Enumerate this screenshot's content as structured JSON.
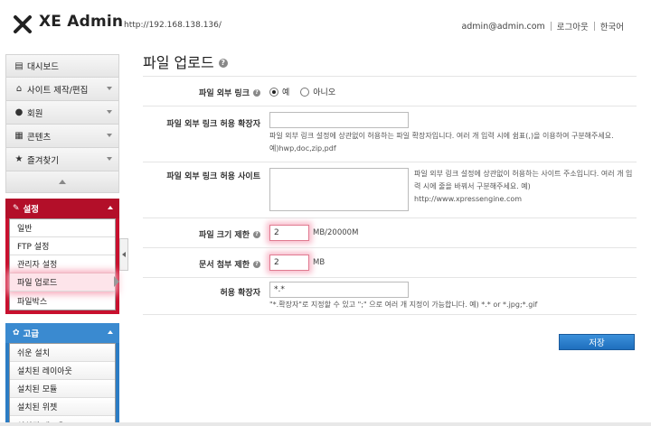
{
  "header": {
    "logo_text": "XE Admin",
    "site_url": "http://192.168.138.136/",
    "user_email": "admin@admin.com",
    "logout": "로그아웃",
    "language": "한국어"
  },
  "sidebar": {
    "items": [
      {
        "label": "대시보드",
        "icon": "dashboard-icon"
      },
      {
        "label": "사이트 제작/편집",
        "icon": "home-icon"
      },
      {
        "label": "회원",
        "icon": "user-icon"
      },
      {
        "label": "콘텐츠",
        "icon": "content-icon"
      },
      {
        "label": "즐겨찾기",
        "icon": "star-icon"
      }
    ],
    "settings_group": {
      "label": "설정",
      "items": [
        "일반",
        "FTP 설정",
        "관리자 설정",
        "파일 업로드",
        "파일박스"
      ],
      "active": "파일 업로드"
    },
    "advanced_group": {
      "label": "고급",
      "items": [
        "쉬운 설치",
        "설치된 레이아웃",
        "설치된 모듈",
        "설치된 위젯",
        "설치된 애드온"
      ]
    }
  },
  "page": {
    "title": "파일 업로드",
    "help": "?"
  },
  "form": {
    "external_link": {
      "label": "파일 외부 링크",
      "options": [
        "예",
        "아니오"
      ],
      "selected": "예"
    },
    "allowed_ext": {
      "label": "파일 외부 링크 허용 확장자",
      "value": "",
      "desc": "파일 외부 링크 설정에 상관없이 허용하는 파일 확장자입니다. 여러 개 입력 시에 쉼표(,)을 이용하여 구분해주세요. 예)hwp,doc,zip,pdf"
    },
    "allowed_sites": {
      "label": "파일 외부 링크 허용 사이트",
      "value": "",
      "desc": "파일 외부 링크 설정에 상관없이 허용하는 사이트 주소입니다. 여러 개 입력 시에 줄을 바꿔서 구분해주세요. 예) http://www.xpressengine.com"
    },
    "file_size": {
      "label": "파일 크기 제한",
      "value": "2",
      "unit": "MB/20000M"
    },
    "doc_attach": {
      "label": "문서 첨부 제한",
      "value": "2",
      "unit": "MB"
    },
    "allowed_types": {
      "label": "허용 확장자",
      "value": "*.*",
      "desc": "\"*.확장자\"로 지정할 수 있고 \";\" 으로 여러 개 지정이 가능합니다. 예) *.* or *.jpg;*.gif"
    },
    "save_label": "저장"
  }
}
